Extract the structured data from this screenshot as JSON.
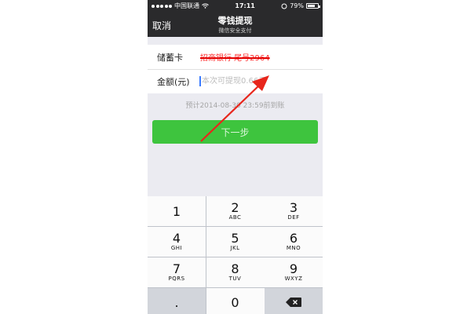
{
  "status_bar": {
    "carrier": "中国联通",
    "time": "17:11",
    "battery_percent": "79%",
    "battery_level": 0.79
  },
  "nav": {
    "back_label": "取消",
    "title": "零钱提现",
    "subtitle": "微信安全支付"
  },
  "form": {
    "card_label": "储蓄卡",
    "card_value": "招商银行 尾号2964",
    "amount_label": "金额(元)",
    "amount_placeholder": "本次可提现0.66元",
    "amount_value": ""
  },
  "eta_text": "预计2014-08-30 23:59前到账",
  "next_button": "下一步",
  "keypad": {
    "keys": [
      {
        "num": "1",
        "letters": ""
      },
      {
        "num": "2",
        "letters": "ABC"
      },
      {
        "num": "3",
        "letters": "DEF"
      },
      {
        "num": "4",
        "letters": "GHI"
      },
      {
        "num": "5",
        "letters": "JKL"
      },
      {
        "num": "6",
        "letters": "MNO"
      },
      {
        "num": "7",
        "letters": "PQRS"
      },
      {
        "num": "8",
        "letters": "TUV"
      },
      {
        "num": "9",
        "letters": "WXYZ"
      }
    ],
    "dot": ".",
    "zero": "0",
    "delete_icon": "backspace-icon"
  },
  "annotation": {
    "arrow_color": "#e8261c",
    "icon": "red-arrow-icon"
  },
  "colors": {
    "nav_bg": "#2a2a2c",
    "button_green": "#3ec43e",
    "strike_red": "#e30000"
  }
}
